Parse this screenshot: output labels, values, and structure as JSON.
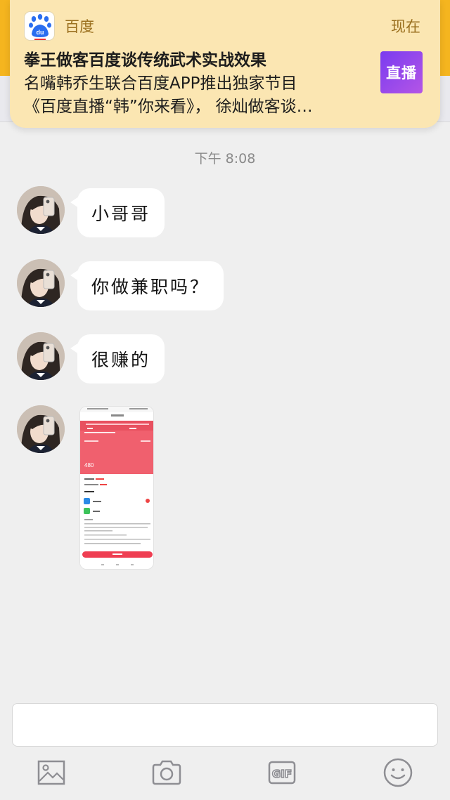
{
  "notification": {
    "app_name": "百度",
    "time": "现在",
    "title": "拳王做客百度谈传统武术实战效果",
    "body_line1": "名嘴韩乔生联合百度APP推出独家节目",
    "body_line2": "《百度直播“韩”你来看》， 徐灿做客谈…",
    "thumb_label": "直播",
    "app_icon_text": "du"
  },
  "chat": {
    "timestamp": "下午 8:08",
    "messages": [
      {
        "type": "text",
        "text": "小哥哥"
      },
      {
        "type": "text",
        "text": "你做兼职吗？"
      },
      {
        "type": "text",
        "text": "很赚的"
      },
      {
        "type": "image"
      }
    ]
  },
  "image_message": {
    "amount": "480"
  },
  "toolbar": {
    "icons": [
      "image-icon",
      "camera-icon",
      "gif-icon",
      "emoji-icon"
    ],
    "gif_label": "GIF"
  },
  "colors": {
    "brand": "#f5b51f",
    "notification_bg": "#fbe6b2",
    "chat_bg": "#efefef",
    "bubble": "#ffffff",
    "accent_red": "#f04a5a"
  }
}
